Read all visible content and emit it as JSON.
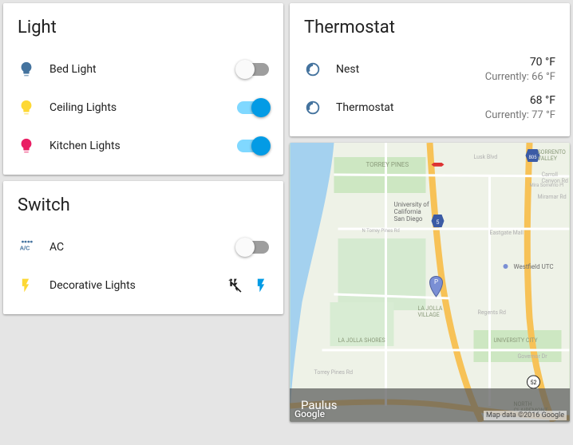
{
  "light": {
    "title": "Light",
    "items": [
      {
        "label": "Bed Light",
        "icon_color": "#44739e",
        "state": "off"
      },
      {
        "label": "Ceiling Lights",
        "icon_color": "#fdd835",
        "state": "on"
      },
      {
        "label": "Kitchen Lights",
        "icon_color": "#e91e63",
        "state": "on"
      }
    ]
  },
  "switch": {
    "title": "Switch",
    "items": [
      {
        "label": "AC",
        "type": "toggle",
        "state": "off",
        "icon": "ac",
        "icon_color": "#44739e"
      },
      {
        "label": "Decorative Lights",
        "type": "flash",
        "icon": "flash",
        "icon_color": "#fdd835"
      }
    ]
  },
  "thermostat": {
    "title": "Thermostat",
    "items": [
      {
        "label": "Nest",
        "target": "70 °F",
        "current": "Currently: 66 °F"
      },
      {
        "label": "Thermostat",
        "target": "68 °F",
        "current": "Currently: 77 °F"
      }
    ]
  },
  "map": {
    "entity_name": "Paulus",
    "attribution": "Map data ©2016 Google",
    "logo": "Google",
    "labels": {
      "ucsd": "University of\nCalifornia\nSan Diego",
      "torrey_pines": "TORREY PINES",
      "sorrento_valley": "SORRENTO\nVALLEY",
      "la_jolla_village": "LA JOLLA\nVILLAGE",
      "la_jolla_shores": "LA JOLLA SHORES",
      "university_city": "UNIVERSITY CITY",
      "north_clairemont": "NORTH\nCLAIREMONT",
      "westfield": "Westfield UTC",
      "lusk": "Lusk Blvd",
      "miramar": "Miramar Rd",
      "eastgate": "Eastgate Mall",
      "governor": "Governor Dr",
      "carroll": "Carroll\nCanyon Rd",
      "mira_sorrento": "Mira Sorrento Pl",
      "regents": "Regents Rd",
      "torrey_pines_rd": "N Torrey Pines Rd"
    }
  }
}
